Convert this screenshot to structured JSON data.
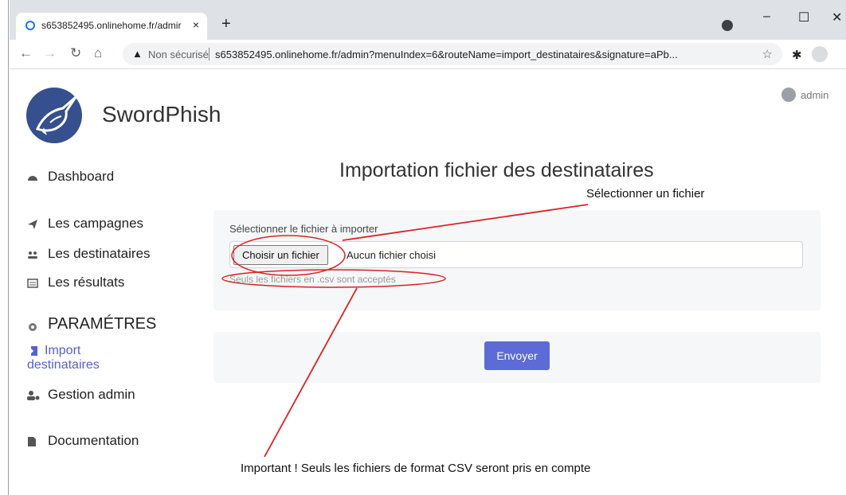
{
  "browser": {
    "tab_title": "s653852495.onlinehome.fr/admir",
    "tab_close": "×",
    "new_tab": "+",
    "minimize": "–",
    "maximize": "☐",
    "close": "✕",
    "insecure_label": "Non sécurisé",
    "url": "s653852495.onlinehome.fr/admin?menuIndex=6&routeName=import_destinataires&signature=aPb..."
  },
  "app": {
    "brand": "SwordPhish",
    "user_name": "admin"
  },
  "sidebar": {
    "items": [
      {
        "label": "Dashboard",
        "icon": "dashboard-icon"
      },
      {
        "label": "Les campagnes",
        "icon": "paper-plane-icon"
      },
      {
        "label": "Les destinataires",
        "icon": "users-icon"
      },
      {
        "label": "Les résultats",
        "icon": "list-icon"
      }
    ],
    "section_title": "PARAMÉTRES",
    "settings_items": [
      {
        "label": "Import destinataires",
        "icon": "import-icon",
        "active": true
      },
      {
        "label": "Gestion admin",
        "icon": "users-cog-icon"
      }
    ],
    "documentation": "Documentation"
  },
  "main": {
    "title": "Importation fichier des destinataires",
    "file_label": "Sélectionner le fichier à importer",
    "choose_button": "Choisir un fichier",
    "no_file": "Aucun fichier choisi",
    "help": "Seuls les fichiers en .csv sont acceptés",
    "submit": "Envoyer"
  },
  "annotations": {
    "select_file": "Sélectionner un fichier",
    "important": "Important ! Seuls les fichiers de format CSV seront pris en compte",
    "color": "#e02020"
  },
  "colors": {
    "accent": "#5c6bd6",
    "active_nav": "#5561d1",
    "logo": "#354f8f"
  }
}
